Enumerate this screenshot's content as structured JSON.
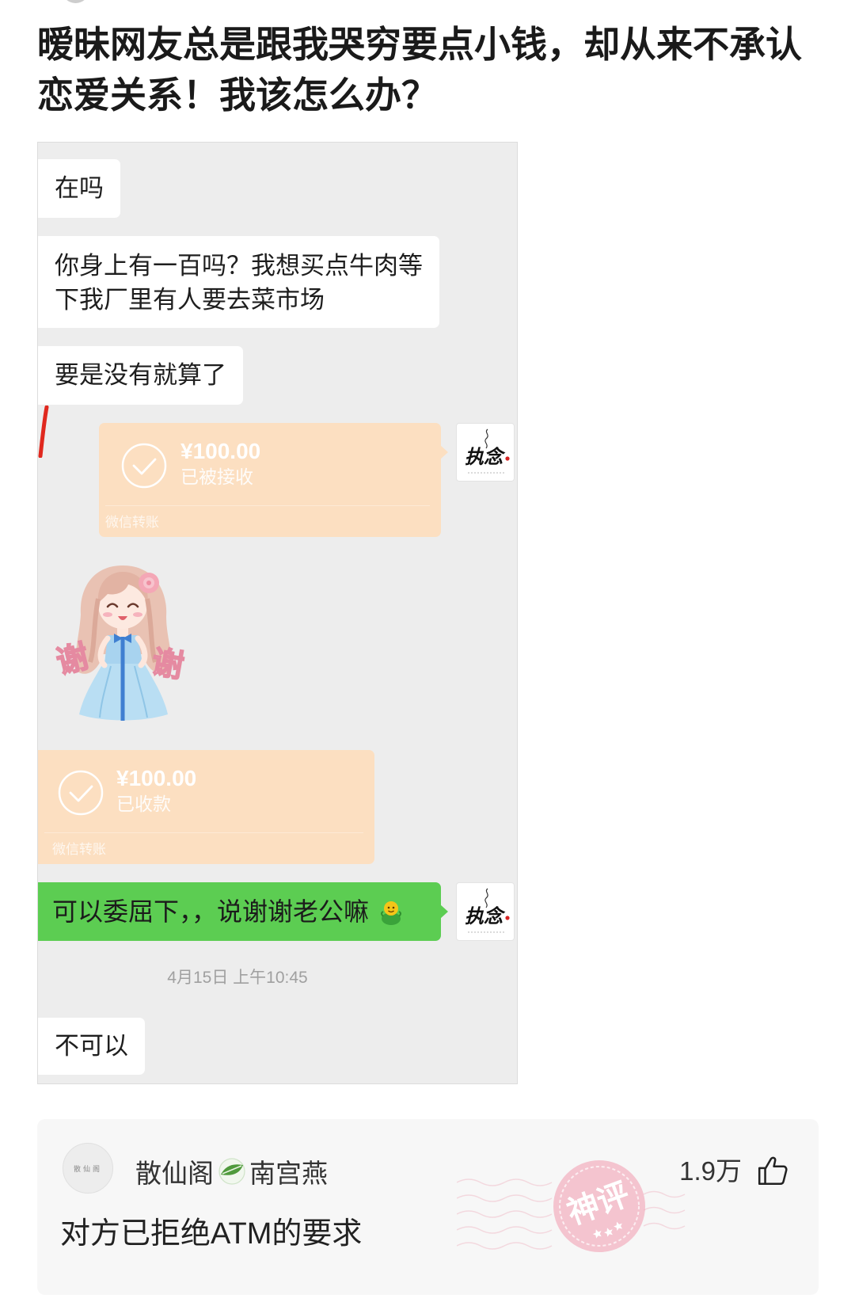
{
  "theme": {
    "chat_bg": "#ededed",
    "incoming_bubble": "#ffffff",
    "outgoing_bubble": "#5ccd52",
    "transfer_card": "#fcdfc1",
    "comment_bg": "#f7f7f7",
    "stamp": "#f2a2b4"
  },
  "post": {
    "title_lines": [
      "暧昧网友总是跟我哭穷要点小钱，却从来不承认",
      "恋爱关系！我该怎么办？"
    ]
  },
  "chat": {
    "msg_1": "在吗",
    "msg_2_lines": [
      "你身上有一百吗？我想买点牛肉等",
      "下我厂里有人要去菜市场"
    ],
    "msg_3": "要是没有就算了",
    "transfer_sent": {
      "amount": "¥100.00",
      "status": "已被接收",
      "footer": "微信转账",
      "icon": "check-circle-icon"
    },
    "my_avatar": {
      "icon": "calligraphy-avatar-icon",
      "text": "执念"
    },
    "sticker": {
      "icon": "thank-you-girl-sticker",
      "chars": [
        "谢",
        "谢"
      ]
    },
    "transfer_received": {
      "amount": "¥100.00",
      "status": "已收款",
      "footer": "微信转账",
      "icon": "check-circle-icon"
    },
    "reply": {
      "text": "可以委屈下，，说谢谢老公嘛",
      "emoji_icon": "smiling-emoji-icon"
    },
    "timestamp": "4月15日 上午10:45",
    "msg_last": "不可以"
  },
  "comment": {
    "avatar_text": "散仙阁",
    "user_name_prefix": "散仙阁",
    "badge_icon": "leaf-badge-icon",
    "user_name_suffix": "南宫燕",
    "likes": "1.9万",
    "like_icon": "thumbs-up-icon",
    "text": "对方已拒绝ATM的要求",
    "stamp_text": "神评"
  }
}
